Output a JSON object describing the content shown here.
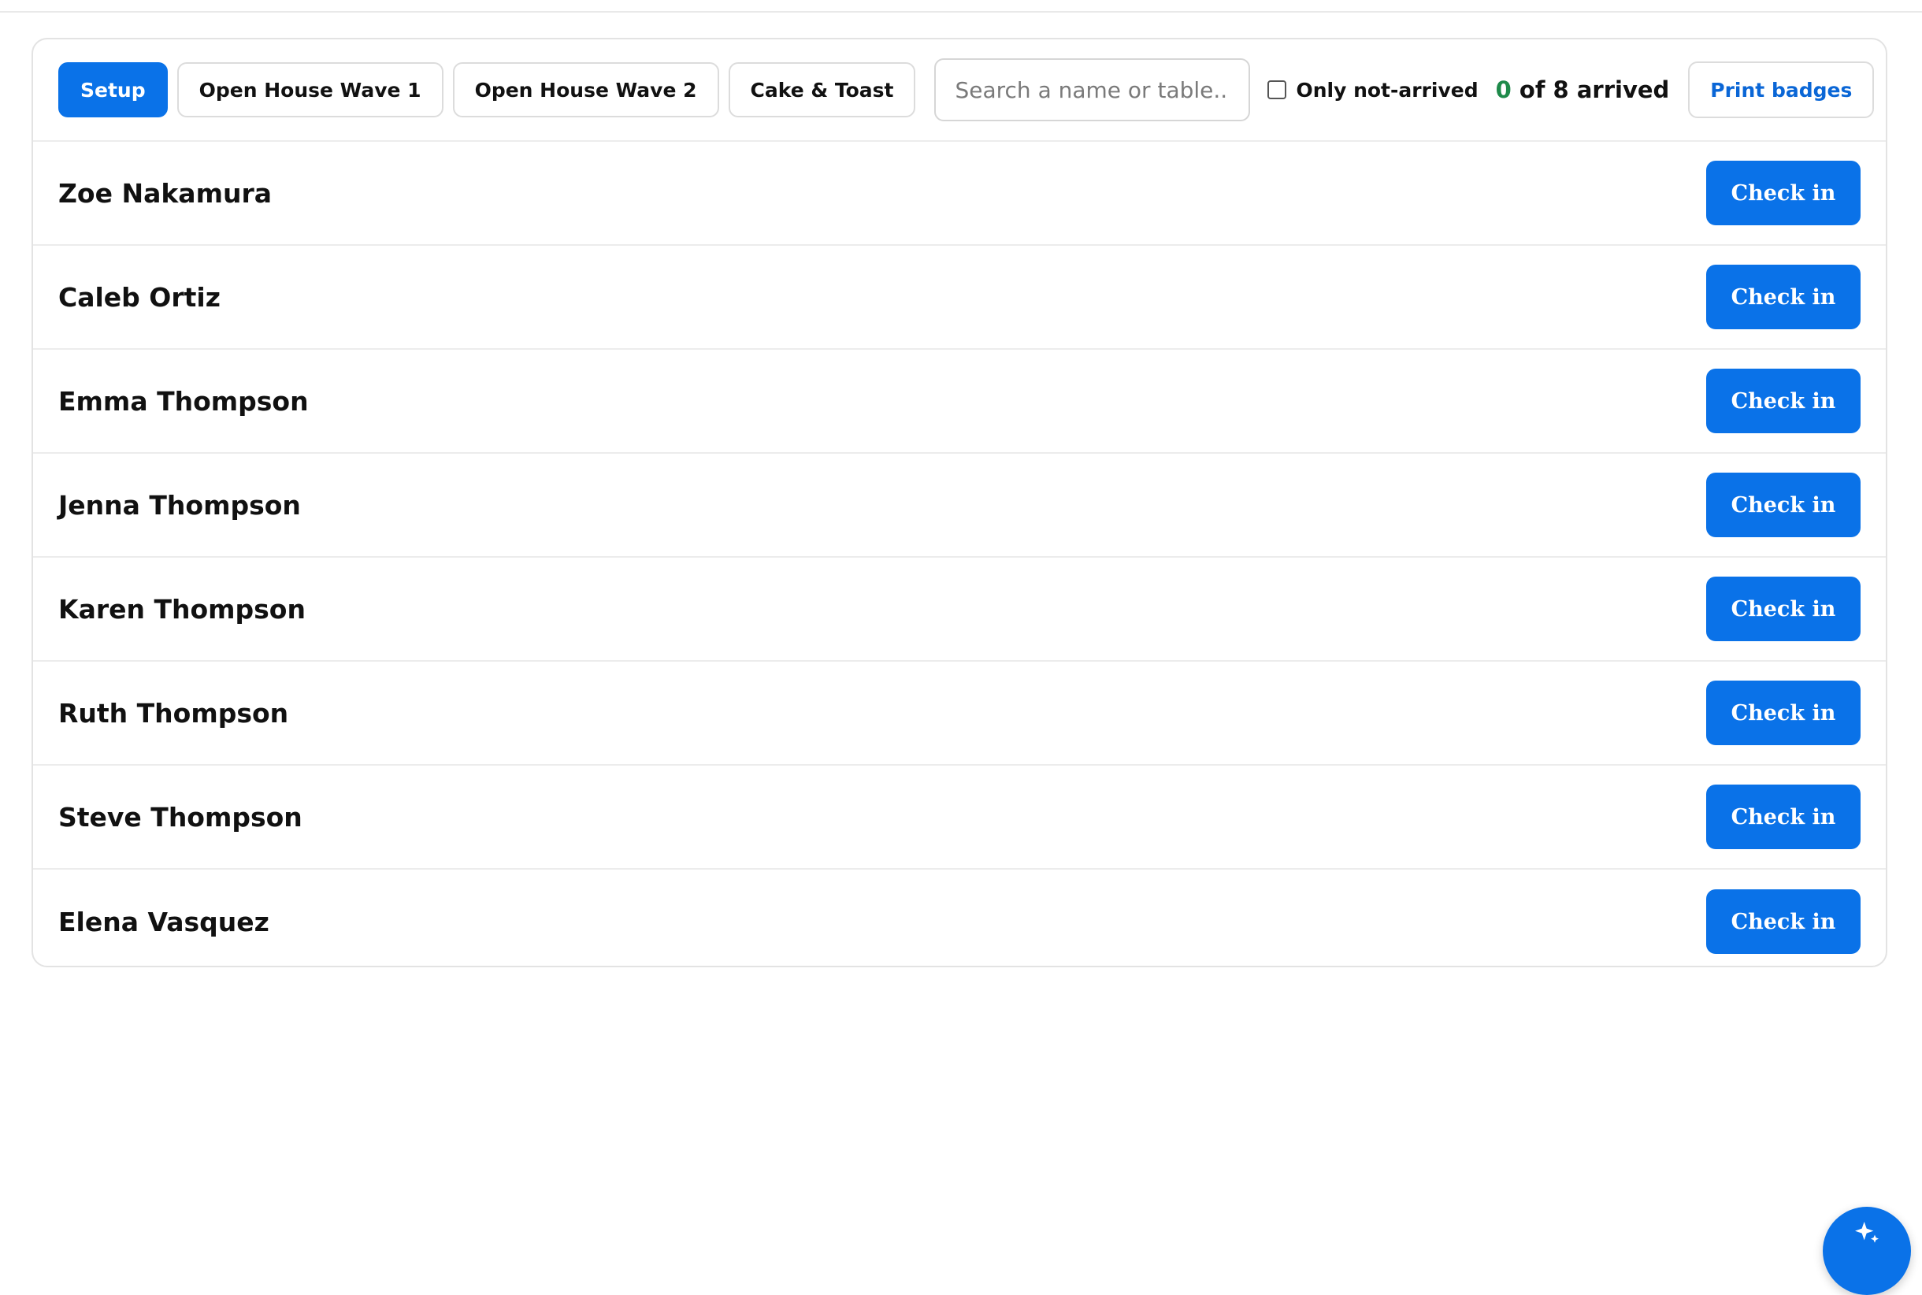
{
  "tabs": [
    {
      "label": "Setup",
      "active": true
    },
    {
      "label": "Open House Wave 1",
      "active": false
    },
    {
      "label": "Open House Wave 2",
      "active": false
    },
    {
      "label": "Cake & Toast",
      "active": false
    }
  ],
  "search": {
    "placeholder": "Search a name or table...",
    "value": ""
  },
  "filter": {
    "label": "Only not-arrived",
    "checked": false
  },
  "counter": {
    "arrived": "0",
    "rest": " of 8 arrived"
  },
  "print": {
    "label": "Print badges"
  },
  "guests": [
    {
      "name": "Zoe Nakamura",
      "action": "Check in"
    },
    {
      "name": "Caleb Ortiz",
      "action": "Check in"
    },
    {
      "name": "Emma Thompson",
      "action": "Check in"
    },
    {
      "name": "Jenna Thompson",
      "action": "Check in"
    },
    {
      "name": "Karen Thompson",
      "action": "Check in"
    },
    {
      "name": "Ruth Thompson",
      "action": "Check in"
    },
    {
      "name": "Steve Thompson",
      "action": "Check in"
    },
    {
      "name": "Elena Vasquez",
      "action": "Check in"
    }
  ],
  "fab": {
    "icon": "sparkle-icon"
  },
  "colors": {
    "accent": "#0a72e8",
    "arrived": "#1e8a4a",
    "link": "#0a66d6"
  }
}
